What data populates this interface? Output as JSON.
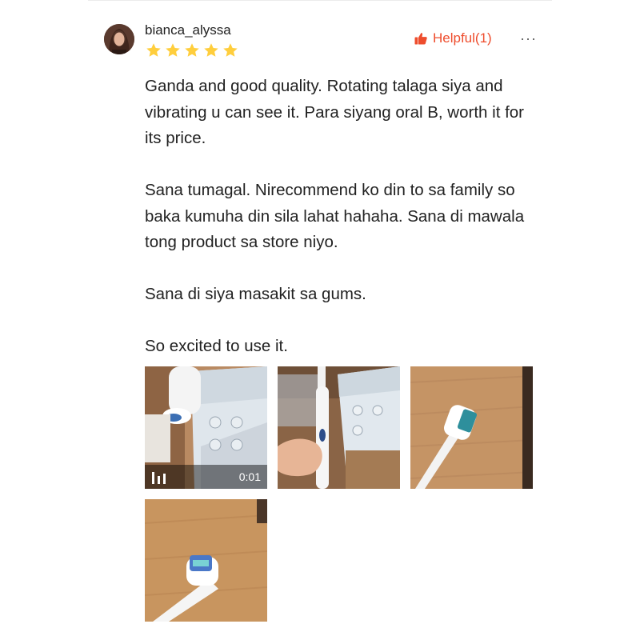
{
  "review": {
    "username": "bianca_alyssa",
    "rating": 5,
    "helpful_label": "Helpful(1)",
    "more_label": "···",
    "paragraphs": [
      "Ganda and good quality. Rotating talaga siya and vibrating u can see it. Para siyang oral B, worth it for its price.",
      "Sana tumagal. Nirecommend ko din to sa family so baka kumuha din sila lahat hahaha. Sana di mawala tong product sa store niyo.",
      "Sana di siya masakit sa gums.",
      "So excited to use it."
    ],
    "video_duration": "0:01"
  },
  "colors": {
    "accent": "#ee4d2d",
    "star": "#ffce3d",
    "text": "#222222"
  },
  "icons": {
    "helpful": "thumbs-up-icon",
    "video": "video-bars-icon",
    "star": "star-icon"
  }
}
